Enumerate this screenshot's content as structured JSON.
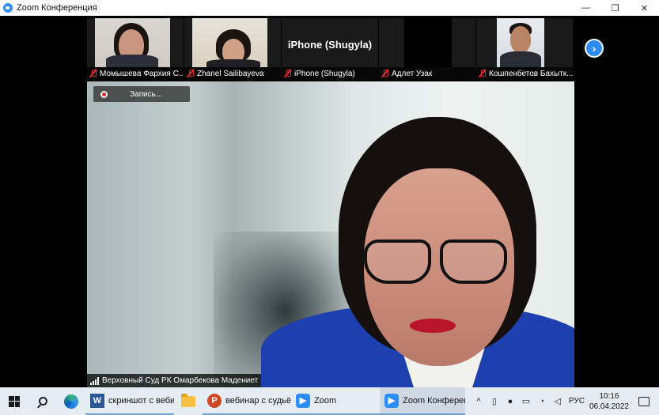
{
  "window": {
    "title": "Zoom Конференция",
    "controls": [
      "—",
      "❐",
      "✕"
    ]
  },
  "thumbnails": [
    {
      "name": "Момышева Фархия С...",
      "muted": true,
      "video": true
    },
    {
      "name": "Zhanel Sailibayeva",
      "muted": true,
      "video": true
    },
    {
      "name": "iPhone (Shugyla)",
      "big_name": "iPhone (Shugyla)",
      "muted": true,
      "video": false
    },
    {
      "name": "Адлет Узак",
      "muted": true,
      "video": false
    },
    {
      "name": "Кошпенбетов Бахытк...",
      "muted": true,
      "video": true
    }
  ],
  "next_arrow": "›",
  "recording": {
    "label": "Запись..."
  },
  "active_speaker": {
    "name": "Верховный Суд РК Омарбекова Мадениет"
  },
  "taskbar": {
    "apps": [
      {
        "label": "скриншот с вебин...",
        "badge": "W",
        "kind": "word"
      },
      {
        "label": "вебинар с судьё...",
        "badge": "P",
        "kind": "ppt"
      },
      {
        "label": "Zoom",
        "badge": "▶",
        "kind": "zoom"
      },
      {
        "label": "Zoom Конферен...",
        "badge": "▶",
        "kind": "zoom",
        "active": true
      }
    ],
    "tray": {
      "chevron": "^",
      "language": "РУС",
      "time": "10:16",
      "date": "06.04.2022"
    }
  },
  "colors": {
    "zoom_blue": "#2d8cff",
    "muted_red": "#e02828",
    "taskbar_bg": "#e6ecf3"
  }
}
